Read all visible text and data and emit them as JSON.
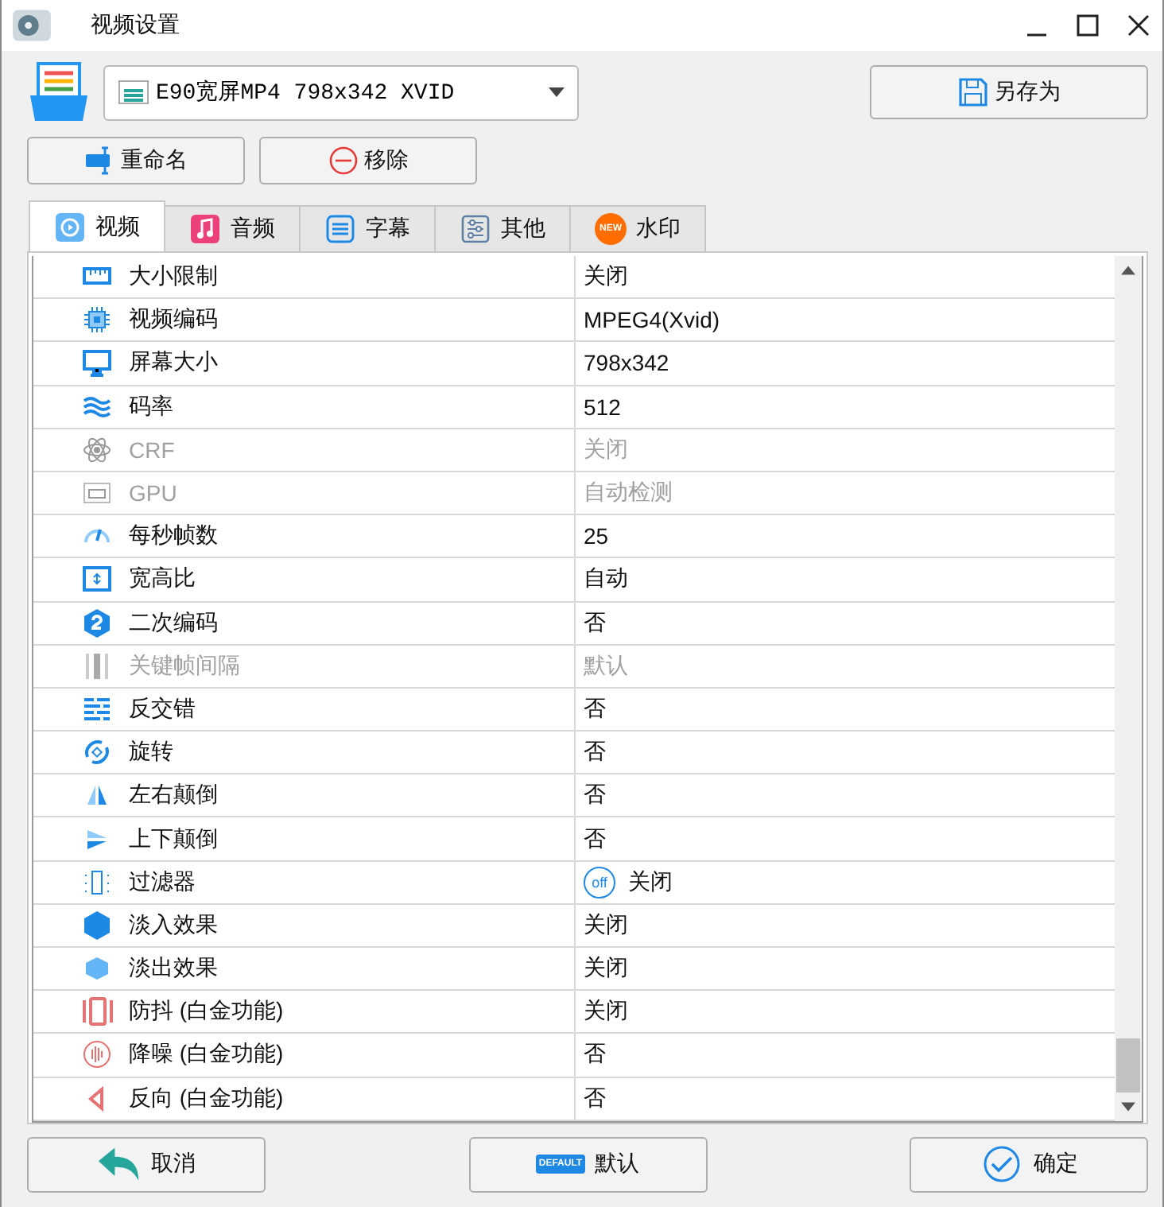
{
  "window": {
    "title": "视频设置"
  },
  "preset": {
    "value": "E90宽屏MP4 798x342 XVID"
  },
  "buttons": {
    "save_as": "另存为",
    "rename": "重命名",
    "remove": "移除"
  },
  "tabs": [
    {
      "label": "视频",
      "selected": true
    },
    {
      "label": "音频",
      "selected": false
    },
    {
      "label": "字幕",
      "selected": false
    },
    {
      "label": "其他",
      "selected": false
    },
    {
      "label": "水印",
      "selected": false
    }
  ],
  "new_badge": "NEW",
  "rows": [
    {
      "label": "大小限制",
      "value": "关闭",
      "disabled": false
    },
    {
      "label": "视频编码",
      "value": "MPEG4(Xvid)",
      "disabled": false
    },
    {
      "label": "屏幕大小",
      "value": "798x342",
      "disabled": false
    },
    {
      "label": "码率",
      "value": "512",
      "disabled": false
    },
    {
      "label": "CRF",
      "value": "关闭",
      "disabled": true
    },
    {
      "label": "GPU",
      "value": "自动检测",
      "disabled": true
    },
    {
      "label": "每秒帧数",
      "value": "25",
      "disabled": false
    },
    {
      "label": "宽高比",
      "value": "自动",
      "disabled": false
    },
    {
      "label": "二次编码",
      "value": "否",
      "disabled": false
    },
    {
      "label": "关键帧间隔",
      "value": "默认",
      "disabled": true
    },
    {
      "label": "反交错",
      "value": "否",
      "disabled": false
    },
    {
      "label": "旋转",
      "value": "否",
      "disabled": false
    },
    {
      "label": "左右颠倒",
      "value": "否",
      "disabled": false
    },
    {
      "label": "上下颠倒",
      "value": "否",
      "disabled": false
    },
    {
      "label": "过滤器",
      "value": "关闭",
      "badge": "off",
      "disabled": false
    },
    {
      "label": "淡入效果",
      "value": "关闭",
      "disabled": false
    },
    {
      "label": "淡出效果",
      "value": "关闭",
      "disabled": false
    },
    {
      "label": "防抖 (白金功能)",
      "value": "关闭",
      "disabled": false
    },
    {
      "label": "降噪 (白金功能)",
      "value": "否",
      "disabled": false
    },
    {
      "label": "反向 (白金功能)",
      "value": "否",
      "disabled": false
    }
  ],
  "footer": {
    "cancel": "取消",
    "default": "默认",
    "default_icon_text": "DEFAULT",
    "ok": "确定"
  }
}
